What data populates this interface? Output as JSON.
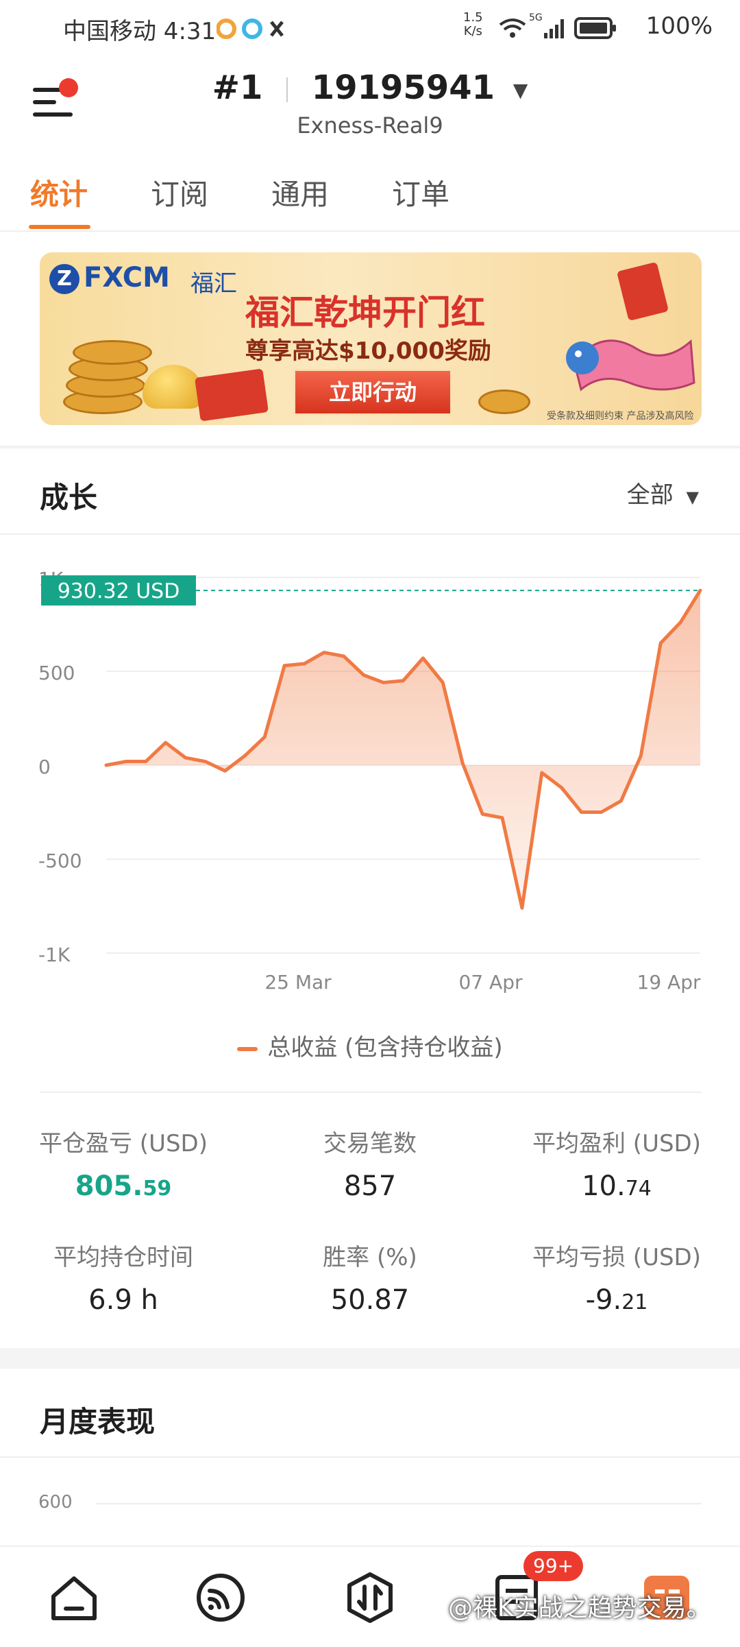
{
  "status_bar": {
    "carrier_time": "中国移动 4:31",
    "net_speed_value": "1.5",
    "net_speed_unit": "K/s",
    "signal": "5G",
    "battery": "100%",
    "icons": [
      "app-icon-1",
      "app-icon-2",
      "app-icon-3",
      "wifi-icon",
      "signal-icon",
      "battery-icon"
    ]
  },
  "header": {
    "rank": "#1",
    "account_number": "19195941",
    "server": "Exness-Real9",
    "menu_icon": "hamburger-icon"
  },
  "tabs": [
    {
      "label": "统计",
      "active": true
    },
    {
      "label": "订阅",
      "active": false
    },
    {
      "label": "通用",
      "active": false
    },
    {
      "label": "订单",
      "active": false
    }
  ],
  "banner": {
    "logo": "FXCM",
    "logo_cn": "福汇",
    "title": "福汇乾坤开门红",
    "subtitle": "尊享高达$10,000奖励",
    "cta": "立即行动",
    "fine_print": "受条款及细则约束  产品涉及高风险"
  },
  "growth": {
    "title": "成长",
    "filter": "全部",
    "current_value_label": "930.32 USD",
    "legend": "总收益 (包含持仓收益)"
  },
  "chart_data": {
    "type": "area",
    "ylim": [
      -1000,
      1000
    ],
    "y_ticks": [
      "1K",
      "500",
      "0",
      "-500",
      "-1K"
    ],
    "x_ticks": [
      "25 Mar",
      "07 Apr",
      "19 Apr"
    ],
    "series": [
      {
        "name": "总收益 (包含持仓收益)",
        "color": "#f07a44",
        "values": [
          0,
          20,
          20,
          120,
          40,
          20,
          -30,
          50,
          150,
          530,
          540,
          600,
          580,
          480,
          440,
          450,
          570,
          440,
          10,
          -260,
          -280,
          -760,
          -40,
          -120,
          -250,
          -250,
          -190,
          50,
          650,
          760,
          930.32
        ]
      }
    ],
    "reference_line": 930.32
  },
  "stats": [
    {
      "label": "平仓盈亏 (USD)",
      "value_main": "805.",
      "value_decimals": "59",
      "color": "#17a589"
    },
    {
      "label": "交易笔数",
      "value_main": "857",
      "value_decimals": ""
    },
    {
      "label": "平均盈利 (USD)",
      "value_main": "10.",
      "value_decimals": "74"
    },
    {
      "label": "平均持仓时间",
      "value_main": "6.9 h",
      "value_decimals": ""
    },
    {
      "label": "胜率 (%)",
      "value_main": "50.87",
      "value_decimals": ""
    },
    {
      "label": "平均亏损 (USD)",
      "value_main": "-9.",
      "value_decimals": "21"
    }
  ],
  "monthly": {
    "title": "月度表现",
    "first_tick": "600"
  },
  "bottom_nav": {
    "items": [
      "home-icon",
      "signal-feed-icon",
      "trade-icon",
      "messages-icon",
      "profile-icon"
    ],
    "badge": "99+"
  },
  "watermark": "@裸K实战之趋势交易。"
}
